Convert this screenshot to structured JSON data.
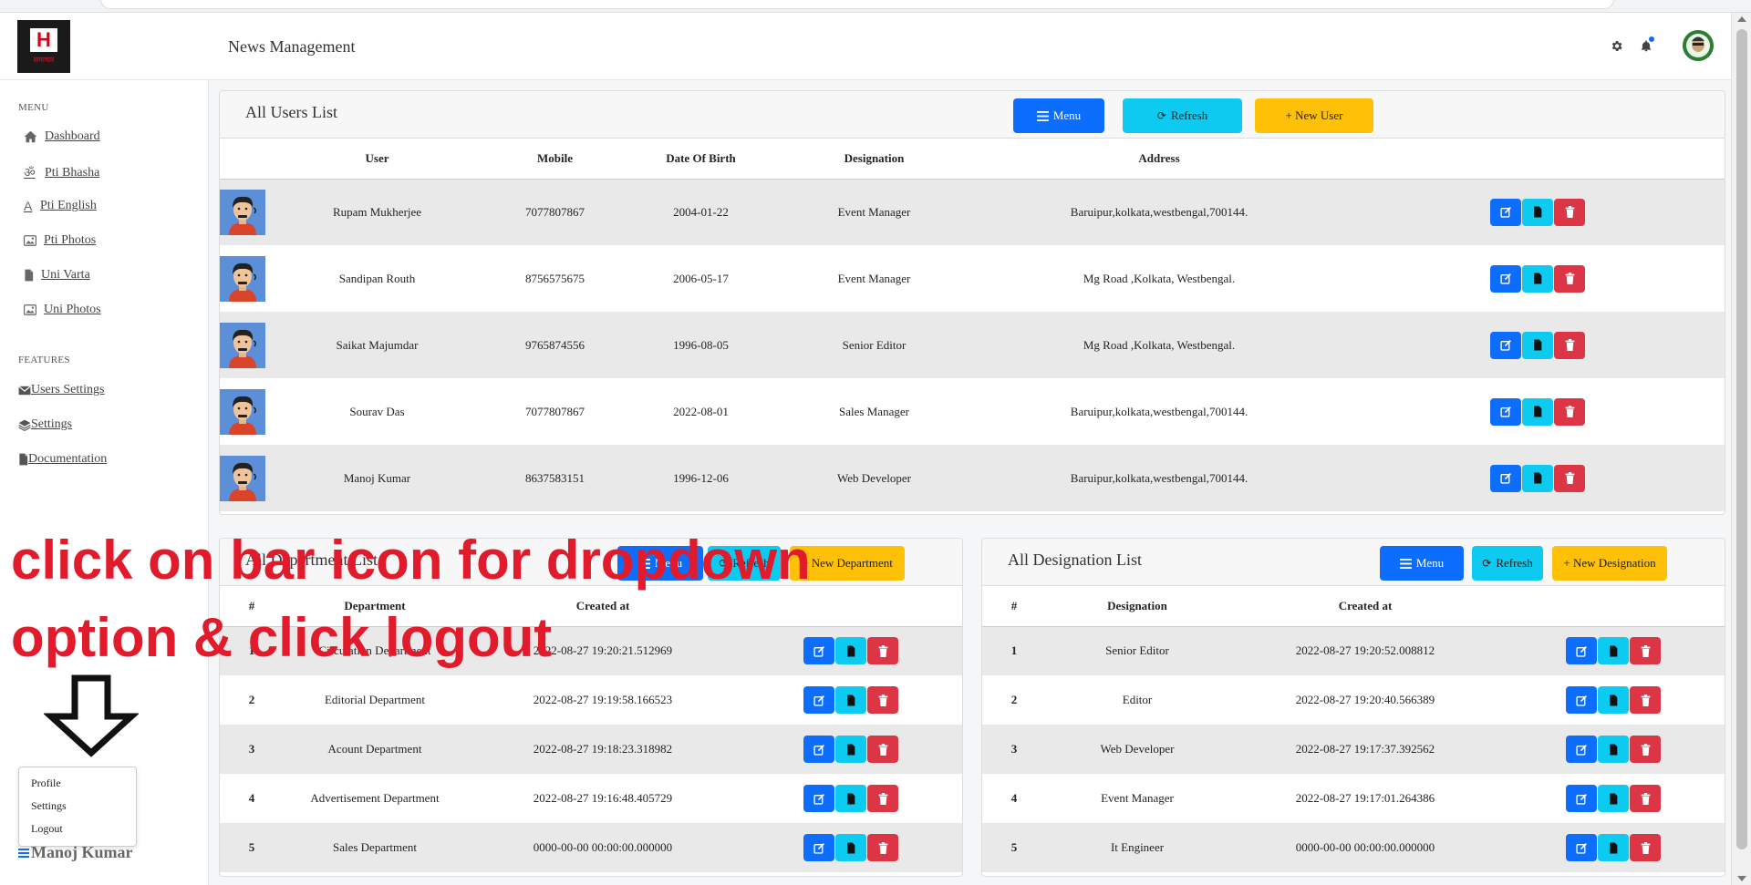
{
  "header": {
    "logo_text": "H",
    "logo_sub": "समाचार",
    "title": "News Management",
    "icons": [
      "gear-icon",
      "bell-icon"
    ]
  },
  "sidebar": {
    "menu_heading": "MENU",
    "menu_items": [
      {
        "label": "Dashboard",
        "icon": "home-icon"
      },
      {
        "label": "Pti Bhasha",
        "icon": "om-icon"
      },
      {
        "label": "Pti English",
        "icon": "letter-a-icon"
      },
      {
        "label": "Pti Photos",
        "icon": "image-icon"
      },
      {
        "label": "Uni Varta",
        "icon": "file-icon"
      },
      {
        "label": "Uni Photos",
        "icon": "image-icon"
      }
    ],
    "features_heading": "FEATURES",
    "feature_items": [
      {
        "label": "Users Settings",
        "icon": "envelope-icon"
      },
      {
        "label": "Settings",
        "icon": "layers-icon"
      },
      {
        "label": "Documentation",
        "icon": "file-icon"
      }
    ],
    "dropdown": [
      "Profile",
      "Settings",
      "Logout"
    ],
    "user_name": "Manoj Kumar"
  },
  "users_card": {
    "title": "All Users List",
    "buttons": {
      "menu": "Menu",
      "refresh": "Refresh",
      "new": "+ New User"
    },
    "columns": [
      "User",
      "Mobile",
      "Date Of Birth",
      "Designation",
      "Address"
    ],
    "rows": [
      {
        "name": "Rupam Mukherjee",
        "mobile": "7077807867",
        "dob": "2004-01-22",
        "designation": "Event Manager",
        "address": "Baruipur,kolkata,westbengal,700144."
      },
      {
        "name": "Sandipan Routh",
        "mobile": "8756575675",
        "dob": "2006-05-17",
        "designation": "Event Manager",
        "address": "Mg Road ,Kolkata, Westbengal."
      },
      {
        "name": "Saikat Majumdar",
        "mobile": "9765874556",
        "dob": "1996-08-05",
        "designation": "Senior Editor",
        "address": "Mg Road ,Kolkata, Westbengal."
      },
      {
        "name": "Sourav Das",
        "mobile": "7077807867",
        "dob": "2022-08-01",
        "designation": "Sales Manager",
        "address": "Baruipur,kolkata,westbengal,700144."
      },
      {
        "name": "Manoj Kumar",
        "mobile": "8637583151",
        "dob": "1996-12-06",
        "designation": "Web Developer",
        "address": "Baruipur,kolkata,westbengal,700144."
      }
    ]
  },
  "department_card": {
    "title": "All Department List",
    "buttons": {
      "menu": "Menu",
      "refresh": "Refresh",
      "new": "+ New Department"
    },
    "columns": [
      "#",
      "Department",
      "Created at"
    ],
    "rows": [
      {
        "num": "1",
        "name": "Circulation Department",
        "created": "2022-08-27 19:20:21.512969"
      },
      {
        "num": "2",
        "name": "Editorial Department",
        "created": "2022-08-27 19:19:58.166523"
      },
      {
        "num": "3",
        "name": "Acount Department",
        "created": "2022-08-27 19:18:23.318982"
      },
      {
        "num": "4",
        "name": "Advertisement Department",
        "created": "2022-08-27 19:16:48.405729"
      },
      {
        "num": "5",
        "name": "Sales Department",
        "created": "0000-00-00 00:00:00.000000"
      }
    ]
  },
  "designation_card": {
    "title": "All Designation List",
    "buttons": {
      "menu": "Menu",
      "refresh": "Refresh",
      "new": "+ New Designation"
    },
    "columns": [
      "#",
      "Designation",
      "Created at"
    ],
    "rows": [
      {
        "num": "1",
        "name": "Senior Editor",
        "created": "2022-08-27 19:20:52.008812"
      },
      {
        "num": "2",
        "name": "Editor",
        "created": "2022-08-27 19:20:40.566389"
      },
      {
        "num": "3",
        "name": "Web Developer",
        "created": "2022-08-27 19:17:37.392562"
      },
      {
        "num": "4",
        "name": "Event Manager",
        "created": "2022-08-27 19:17:01.264386"
      },
      {
        "num": "5",
        "name": "It Engineer",
        "created": "0000-00-00 00:00:00.000000"
      }
    ]
  },
  "annotation": {
    "line1": "click on bar icon for dropdown",
    "line2": "option & click logout",
    "color": "#e11b2c"
  },
  "colors": {
    "primary": "#0d6efd",
    "info": "#0dcaf0",
    "warning": "#ffc107",
    "danger": "#dc3545"
  }
}
